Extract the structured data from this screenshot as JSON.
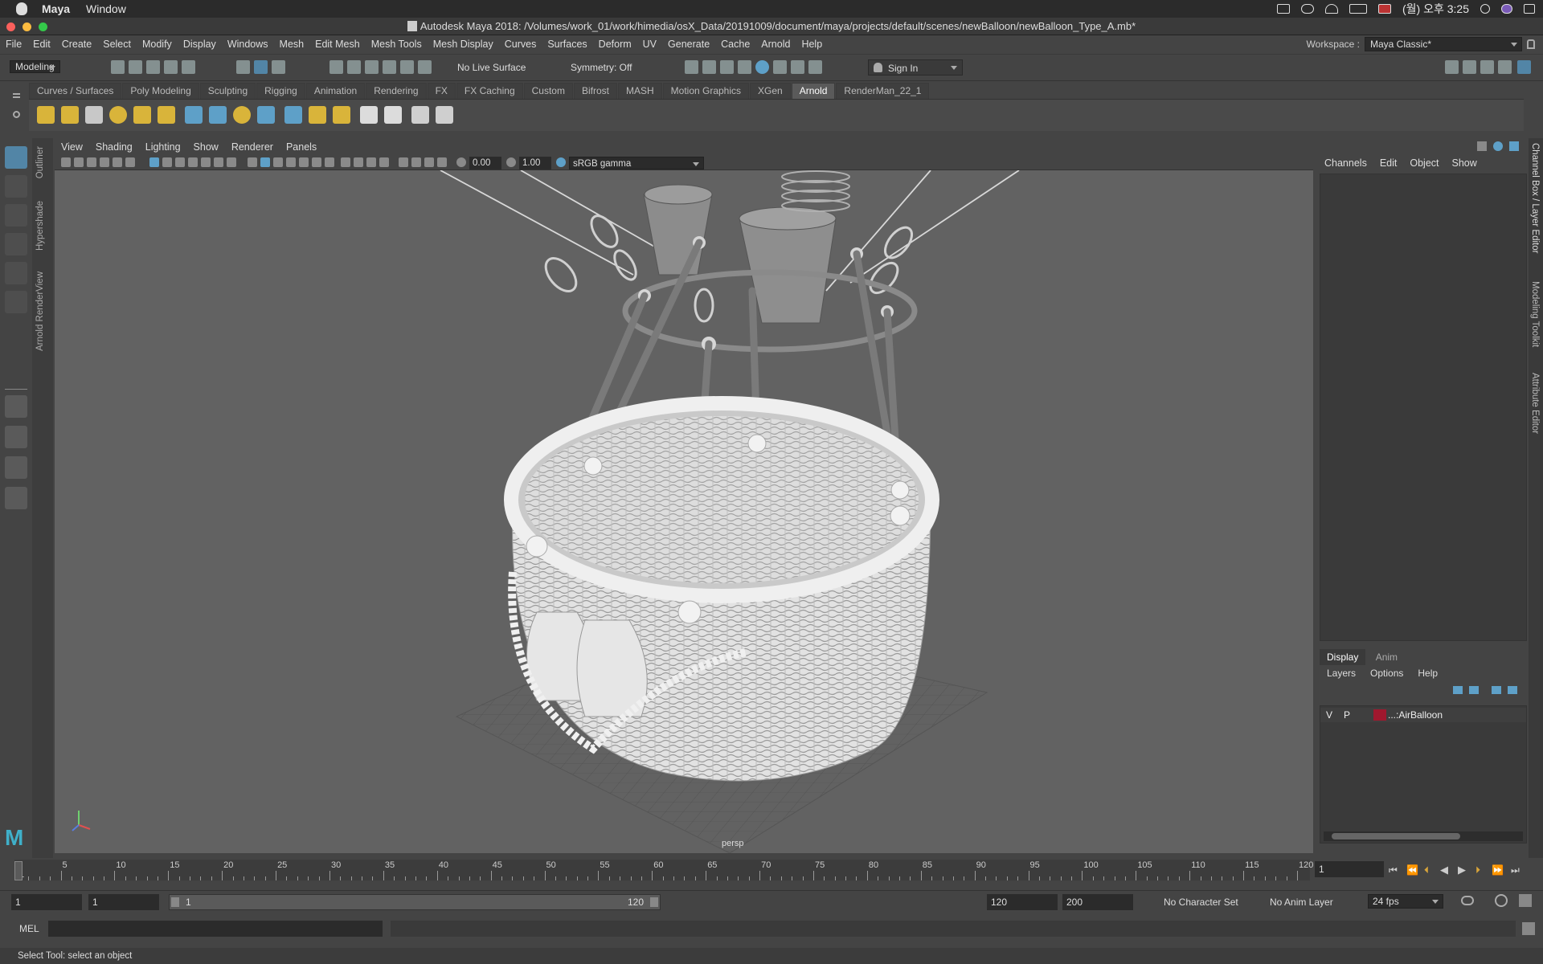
{
  "mac_menubar": {
    "items": [
      "Maya",
      "Window"
    ],
    "clock": "(월) 오후 3:25"
  },
  "window": {
    "title": "Autodesk Maya 2018: /Volumes/work_01/work/himedia/osX_Data/20191009/document/maya/projects/default/scenes/newBalloon/newBalloon_Type_A.mb*"
  },
  "main_menu": {
    "items": [
      "File",
      "Edit",
      "Create",
      "Select",
      "Modify",
      "Display",
      "Windows",
      "Mesh",
      "Edit Mesh",
      "Mesh Tools",
      "Mesh Display",
      "Curves",
      "Surfaces",
      "Deform",
      "UV",
      "Generate",
      "Cache",
      "Arnold",
      "Help"
    ]
  },
  "workspace": {
    "label": "Workspace :",
    "value": "Maya Classic*"
  },
  "status_line": {
    "menu_set": "Modeling",
    "live_surface": "No Live Surface",
    "symmetry": "Symmetry: Off",
    "sign_in": "Sign In"
  },
  "shelf": {
    "tabs": [
      "Curves / Surfaces",
      "Poly Modeling",
      "Sculpting",
      "Rigging",
      "Animation",
      "Rendering",
      "FX",
      "FX Caching",
      "Custom",
      "Bifrost",
      "MASH",
      "Motion Graphics",
      "XGen",
      "Arnold",
      "RenderMan_22_1"
    ],
    "active_tab": "Arnold"
  },
  "left_vertical_tabs": [
    "Outliner",
    "Hypershade",
    "Arnold RenderView"
  ],
  "viewport": {
    "menu": [
      "View",
      "Shading",
      "Lighting",
      "Show",
      "Renderer",
      "Panels"
    ],
    "exposure": "0.00",
    "gamma": "1.00",
    "color_space": "sRGB gamma",
    "camera_label": "persp"
  },
  "channel_box": {
    "menu": [
      "Channels",
      "Edit",
      "Object",
      "Show"
    ]
  },
  "layer_editor": {
    "tabs": [
      "Display",
      "Anim"
    ],
    "active_tab": "Display",
    "menu": [
      "Layers",
      "Options",
      "Help"
    ],
    "layers": [
      {
        "v": "V",
        "p": "P",
        "name": "...:AirBalloon",
        "color": "#a0182e"
      }
    ]
  },
  "right_vertical_tabs": [
    "Channel Box / Layer Editor",
    "Modeling Toolkit",
    "Attribute Editor"
  ],
  "time_slider": {
    "labels": [
      "1",
      "5",
      "10",
      "15",
      "20",
      "25",
      "30",
      "35",
      "40",
      "45",
      "50",
      "55",
      "60",
      "65",
      "70",
      "75",
      "80",
      "85",
      "90",
      "95",
      "100",
      "105",
      "110",
      "115",
      "120"
    ],
    "current_frame": "1"
  },
  "range_slider": {
    "start": "1",
    "playback_start": "1",
    "range_start_label": "1",
    "range_end_label": "120",
    "playback_end": "120",
    "end": "200",
    "character_set": "No Character Set",
    "anim_layer": "No Anim Layer",
    "fps": "24 fps"
  },
  "command_line": {
    "label": "MEL"
  },
  "help_line": {
    "text": "Select Tool: select an object"
  },
  "colors": {
    "accent": "#5285a6",
    "selected_icon": "#5ea0c8"
  }
}
